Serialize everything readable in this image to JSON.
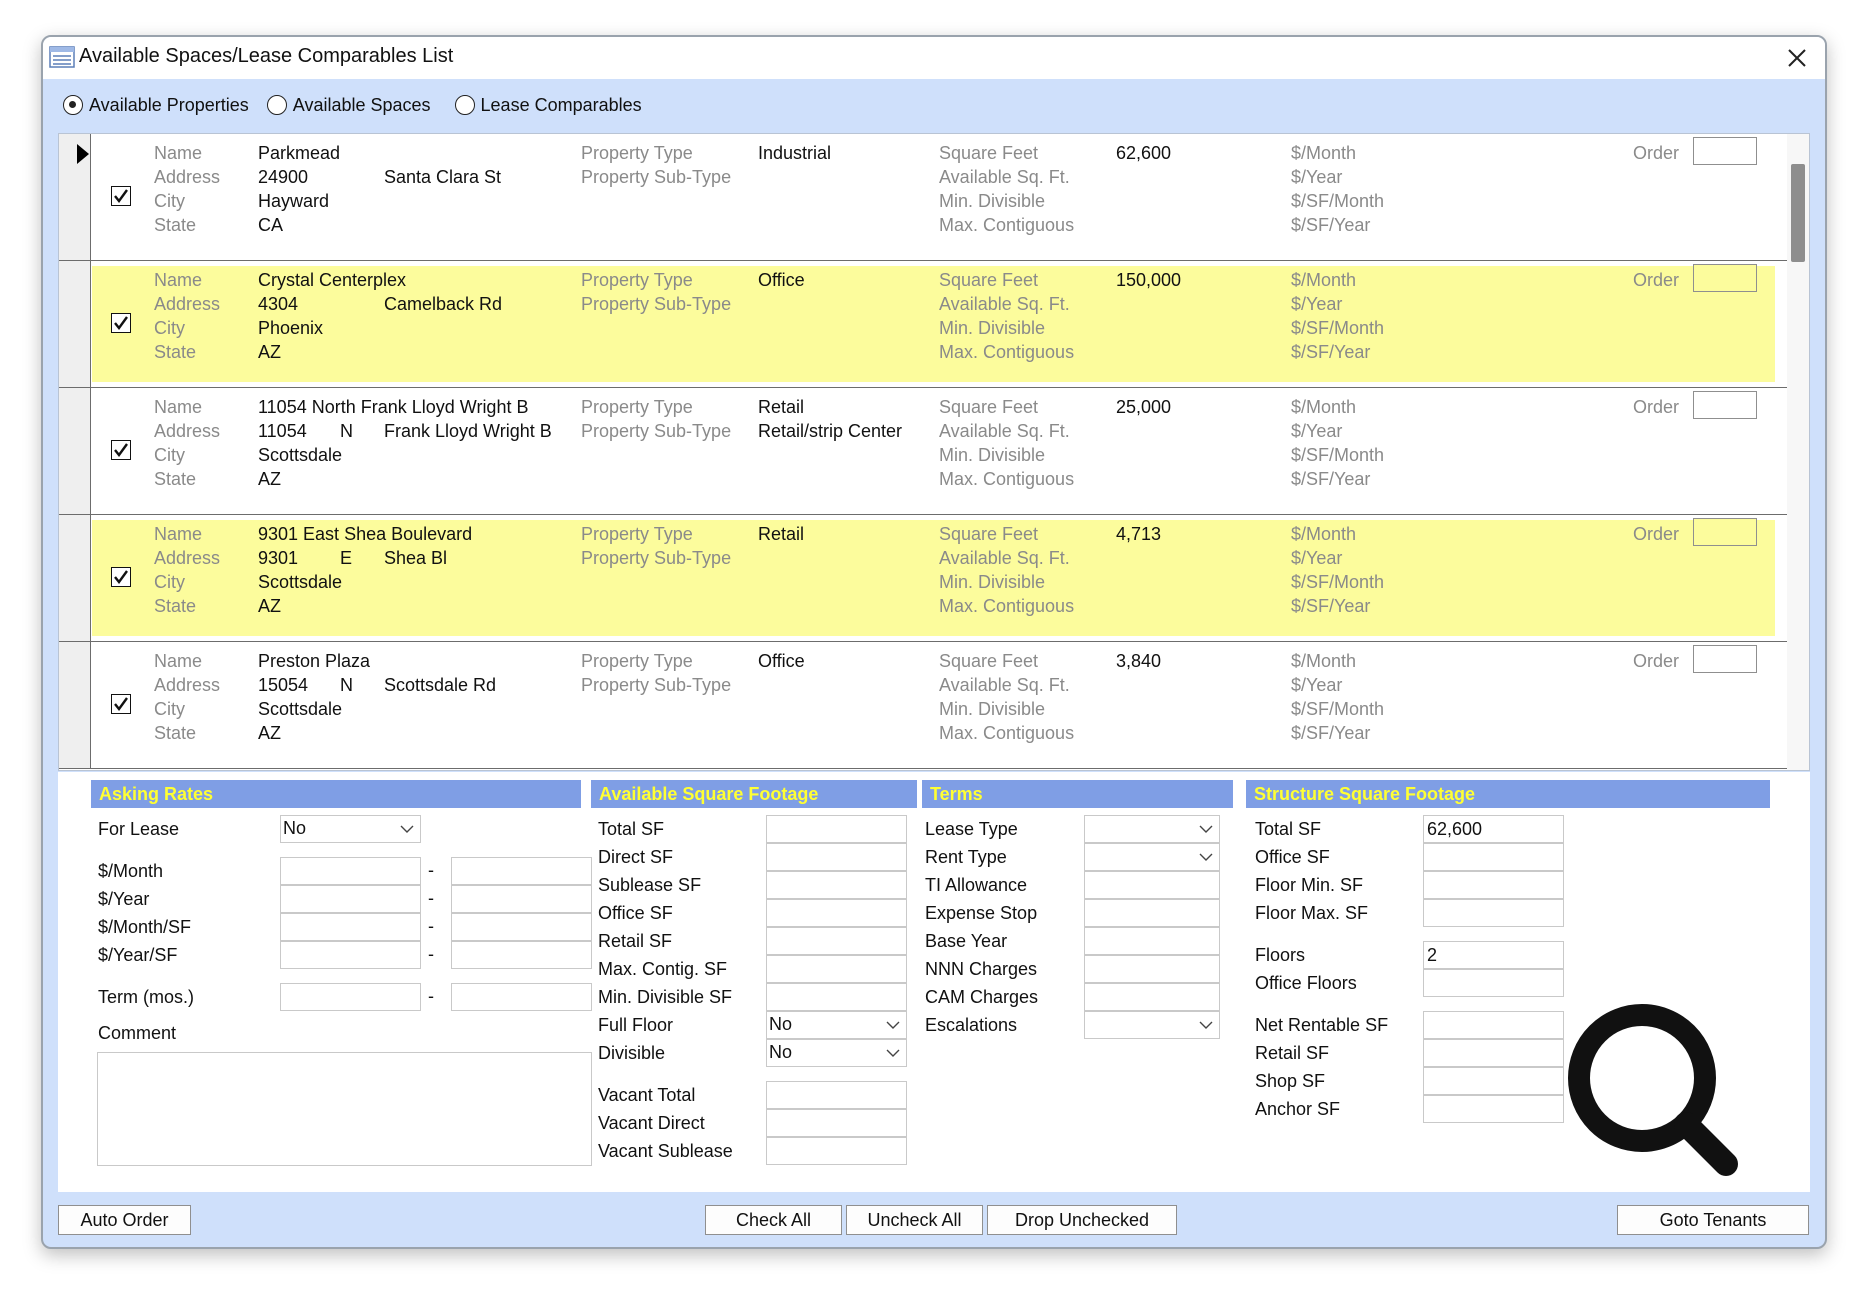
{
  "window": {
    "title": "Available Spaces/Lease Comparables List",
    "close_glyph": "✕"
  },
  "mode_options": {
    "available_properties": "Available Properties",
    "available_spaces": "Available Spaces",
    "lease_comparables": "Lease Comparables",
    "selected": "available_properties"
  },
  "labels": {
    "name": "Name",
    "address": "Address",
    "city": "City",
    "state": "State",
    "property_type": "Property Type",
    "property_sub_type": "Property Sub-Type",
    "square_feet": "Square Feet",
    "available_sqft": "Available Sq. Ft.",
    "min_divisible": "Min. Divisible",
    "max_contiguous": "Max. Contiguous",
    "per_month": "$/Month",
    "per_year": "$/Year",
    "per_sf_month": "$/SF/Month",
    "per_sf_year": "$/SF/Year",
    "order": "Order"
  },
  "records": [
    {
      "checked": true,
      "highlight": false,
      "current": true,
      "name": "Parkmead",
      "address_number": "24900",
      "address_dir": "",
      "address_street": "Santa Clara St",
      "city": "Hayward",
      "state": "CA",
      "property_type": "Industrial",
      "property_sub_type": "",
      "square_feet": "62,600"
    },
    {
      "checked": true,
      "highlight": true,
      "current": false,
      "name": "Crystal Centerplex",
      "address_number": "4304",
      "address_dir": "",
      "address_street": "Camelback Rd",
      "city": "Phoenix",
      "state": "AZ",
      "property_type": "Office",
      "property_sub_type": "",
      "square_feet": "150,000"
    },
    {
      "checked": true,
      "highlight": false,
      "current": false,
      "name": "11054 North Frank Lloyd Wright B",
      "address_number": "11054",
      "address_dir": "N",
      "address_street": "Frank Lloyd Wright B",
      "city": "Scottsdale",
      "state": "AZ",
      "property_type": "Retail",
      "property_sub_type": "Retail/strip Center",
      "square_feet": "25,000"
    },
    {
      "checked": true,
      "highlight": true,
      "current": false,
      "name": "9301 East Shea Boulevard",
      "address_number": "9301",
      "address_dir": "E",
      "address_street": "Shea Bl",
      "city": "Scottsdale",
      "state": "AZ",
      "property_type": "Retail",
      "property_sub_type": "",
      "square_feet": "4,713"
    },
    {
      "checked": true,
      "highlight": false,
      "current": false,
      "name": "Preston Plaza",
      "address_number": "15054",
      "address_dir": "N",
      "address_street": "Scottsdale Rd",
      "city": "Scottsdale",
      "state": "AZ",
      "property_type": "Office",
      "property_sub_type": "",
      "square_feet": "3,840"
    }
  ],
  "asking_rates": {
    "header": "Asking Rates",
    "for_lease_label": "For Lease",
    "for_lease_value": "No",
    "per_month": "$/Month",
    "per_year": "$/Year",
    "per_month_sf": "$/Month/SF",
    "per_year_sf": "$/Year/SF",
    "term": "Term (mos.)",
    "comment": "Comment",
    "range_sep": "-"
  },
  "available_sf": {
    "header": "Available Square Footage",
    "total_sf": "Total SF",
    "direct_sf": "Direct SF",
    "sublease_sf": "Sublease SF",
    "office_sf": "Office SF",
    "retail_sf": "Retail SF",
    "max_contig_sf": "Max. Contig. SF",
    "min_divisible_sf": "Min. Divisible SF",
    "full_floor": "Full Floor",
    "full_floor_value": "No",
    "divisible": "Divisible",
    "divisible_value": "No",
    "vacant_total": "Vacant Total",
    "vacant_direct": "Vacant Direct",
    "vacant_sublease": "Vacant Sublease"
  },
  "terms": {
    "header": "Terms",
    "lease_type": "Lease Type",
    "rent_type": "Rent Type",
    "ti_allowance": "TI Allowance",
    "expense_stop": "Expense Stop",
    "base_year": "Base Year",
    "nnn_charges": "NNN Charges",
    "cam_charges": "CAM Charges",
    "escalations": "Escalations"
  },
  "structure_sf": {
    "header": "Structure Square Footage",
    "total_sf": "Total SF",
    "total_sf_value": "62,600",
    "office_sf": "Office SF",
    "floor_min_sf": "Floor Min. SF",
    "floor_max_sf": "Floor Max. SF",
    "floors": "Floors",
    "floors_value": "2",
    "office_floors": "Office Floors",
    "net_rentable_sf": "Net Rentable SF",
    "retail_sf": "Retail SF",
    "shop_sf": "Shop SF",
    "anchor_sf": "Anchor SF"
  },
  "buttons": {
    "auto_order": "Auto Order",
    "check_all": "Check All",
    "uncheck_all": "Uncheck All",
    "drop_unchecked": "Drop Unchecked",
    "goto_tenants": "Goto Tenants"
  },
  "icons": {
    "app": "list-window-icon",
    "search": "magnifier-icon",
    "close": "close-icon"
  }
}
